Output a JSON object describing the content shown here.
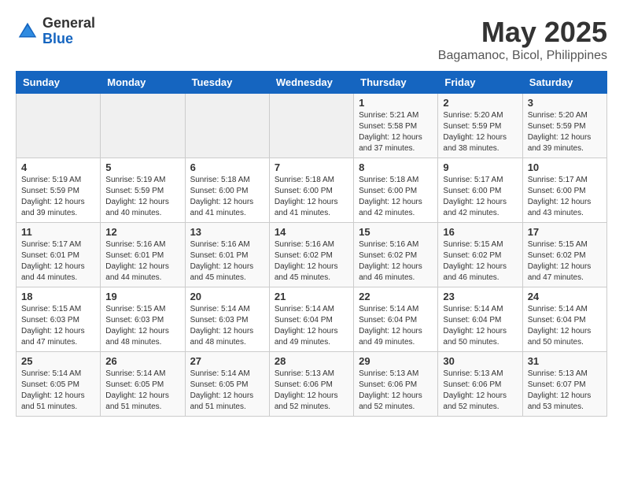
{
  "logo": {
    "general": "General",
    "blue": "Blue"
  },
  "title": "May 2025",
  "location": "Bagamanoc, Bicol, Philippines",
  "days_header": [
    "Sunday",
    "Monday",
    "Tuesday",
    "Wednesday",
    "Thursday",
    "Friday",
    "Saturday"
  ],
  "weeks": [
    [
      {
        "day": "",
        "info": ""
      },
      {
        "day": "",
        "info": ""
      },
      {
        "day": "",
        "info": ""
      },
      {
        "day": "",
        "info": ""
      },
      {
        "day": "1",
        "info": "Sunrise: 5:21 AM\nSunset: 5:58 PM\nDaylight: 12 hours\nand 37 minutes."
      },
      {
        "day": "2",
        "info": "Sunrise: 5:20 AM\nSunset: 5:59 PM\nDaylight: 12 hours\nand 38 minutes."
      },
      {
        "day": "3",
        "info": "Sunrise: 5:20 AM\nSunset: 5:59 PM\nDaylight: 12 hours\nand 39 minutes."
      }
    ],
    [
      {
        "day": "4",
        "info": "Sunrise: 5:19 AM\nSunset: 5:59 PM\nDaylight: 12 hours\nand 39 minutes."
      },
      {
        "day": "5",
        "info": "Sunrise: 5:19 AM\nSunset: 5:59 PM\nDaylight: 12 hours\nand 40 minutes."
      },
      {
        "day": "6",
        "info": "Sunrise: 5:18 AM\nSunset: 6:00 PM\nDaylight: 12 hours\nand 41 minutes."
      },
      {
        "day": "7",
        "info": "Sunrise: 5:18 AM\nSunset: 6:00 PM\nDaylight: 12 hours\nand 41 minutes."
      },
      {
        "day": "8",
        "info": "Sunrise: 5:18 AM\nSunset: 6:00 PM\nDaylight: 12 hours\nand 42 minutes."
      },
      {
        "day": "9",
        "info": "Sunrise: 5:17 AM\nSunset: 6:00 PM\nDaylight: 12 hours\nand 42 minutes."
      },
      {
        "day": "10",
        "info": "Sunrise: 5:17 AM\nSunset: 6:00 PM\nDaylight: 12 hours\nand 43 minutes."
      }
    ],
    [
      {
        "day": "11",
        "info": "Sunrise: 5:17 AM\nSunset: 6:01 PM\nDaylight: 12 hours\nand 44 minutes."
      },
      {
        "day": "12",
        "info": "Sunrise: 5:16 AM\nSunset: 6:01 PM\nDaylight: 12 hours\nand 44 minutes."
      },
      {
        "day": "13",
        "info": "Sunrise: 5:16 AM\nSunset: 6:01 PM\nDaylight: 12 hours\nand 45 minutes."
      },
      {
        "day": "14",
        "info": "Sunrise: 5:16 AM\nSunset: 6:02 PM\nDaylight: 12 hours\nand 45 minutes."
      },
      {
        "day": "15",
        "info": "Sunrise: 5:16 AM\nSunset: 6:02 PM\nDaylight: 12 hours\nand 46 minutes."
      },
      {
        "day": "16",
        "info": "Sunrise: 5:15 AM\nSunset: 6:02 PM\nDaylight: 12 hours\nand 46 minutes."
      },
      {
        "day": "17",
        "info": "Sunrise: 5:15 AM\nSunset: 6:02 PM\nDaylight: 12 hours\nand 47 minutes."
      }
    ],
    [
      {
        "day": "18",
        "info": "Sunrise: 5:15 AM\nSunset: 6:03 PM\nDaylight: 12 hours\nand 47 minutes."
      },
      {
        "day": "19",
        "info": "Sunrise: 5:15 AM\nSunset: 6:03 PM\nDaylight: 12 hours\nand 48 minutes."
      },
      {
        "day": "20",
        "info": "Sunrise: 5:14 AM\nSunset: 6:03 PM\nDaylight: 12 hours\nand 48 minutes."
      },
      {
        "day": "21",
        "info": "Sunrise: 5:14 AM\nSunset: 6:04 PM\nDaylight: 12 hours\nand 49 minutes."
      },
      {
        "day": "22",
        "info": "Sunrise: 5:14 AM\nSunset: 6:04 PM\nDaylight: 12 hours\nand 49 minutes."
      },
      {
        "day": "23",
        "info": "Sunrise: 5:14 AM\nSunset: 6:04 PM\nDaylight: 12 hours\nand 50 minutes."
      },
      {
        "day": "24",
        "info": "Sunrise: 5:14 AM\nSunset: 6:04 PM\nDaylight: 12 hours\nand 50 minutes."
      }
    ],
    [
      {
        "day": "25",
        "info": "Sunrise: 5:14 AM\nSunset: 6:05 PM\nDaylight: 12 hours\nand 51 minutes."
      },
      {
        "day": "26",
        "info": "Sunrise: 5:14 AM\nSunset: 6:05 PM\nDaylight: 12 hours\nand 51 minutes."
      },
      {
        "day": "27",
        "info": "Sunrise: 5:14 AM\nSunset: 6:05 PM\nDaylight: 12 hours\nand 51 minutes."
      },
      {
        "day": "28",
        "info": "Sunrise: 5:13 AM\nSunset: 6:06 PM\nDaylight: 12 hours\nand 52 minutes."
      },
      {
        "day": "29",
        "info": "Sunrise: 5:13 AM\nSunset: 6:06 PM\nDaylight: 12 hours\nand 52 minutes."
      },
      {
        "day": "30",
        "info": "Sunrise: 5:13 AM\nSunset: 6:06 PM\nDaylight: 12 hours\nand 52 minutes."
      },
      {
        "day": "31",
        "info": "Sunrise: 5:13 AM\nSunset: 6:07 PM\nDaylight: 12 hours\nand 53 minutes."
      }
    ]
  ]
}
